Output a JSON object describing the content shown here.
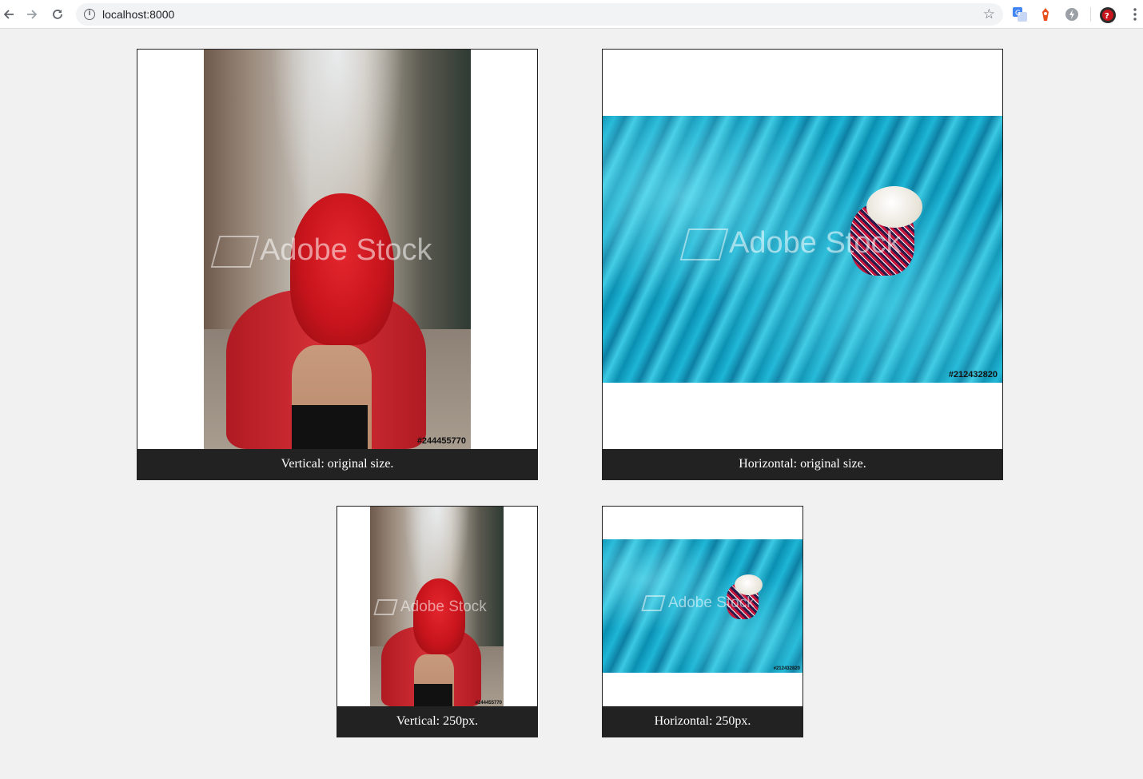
{
  "browser": {
    "url": "localhost:8000",
    "icons": [
      "back-arrow-icon",
      "forward-arrow-icon",
      "reload-icon",
      "info-icon",
      "star-icon",
      "translate-icon",
      "extension-icon",
      "lightning-icon",
      "profile-icon",
      "menu-icon"
    ]
  },
  "figures": [
    {
      "caption": "Vertical: original size.",
      "watermark": "Adobe Stock",
      "stock_id": "#244455770"
    },
    {
      "caption": "Horizontal: original size.",
      "watermark": "Adobe Stock",
      "stock_id": "#212432820"
    },
    {
      "caption": "Vertical: 250px.",
      "watermark": "Adobe Stock",
      "stock_id": "#244455770"
    },
    {
      "caption": "Horizontal: 250px.",
      "watermark": "Adobe Stock",
      "stock_id": "#212432820"
    }
  ],
  "colors": {
    "caption_bg": "#222222",
    "page_bg": "#f1f1f1",
    "scarf_red": "#d0121c",
    "fabric_blue": "#12a4c7"
  }
}
